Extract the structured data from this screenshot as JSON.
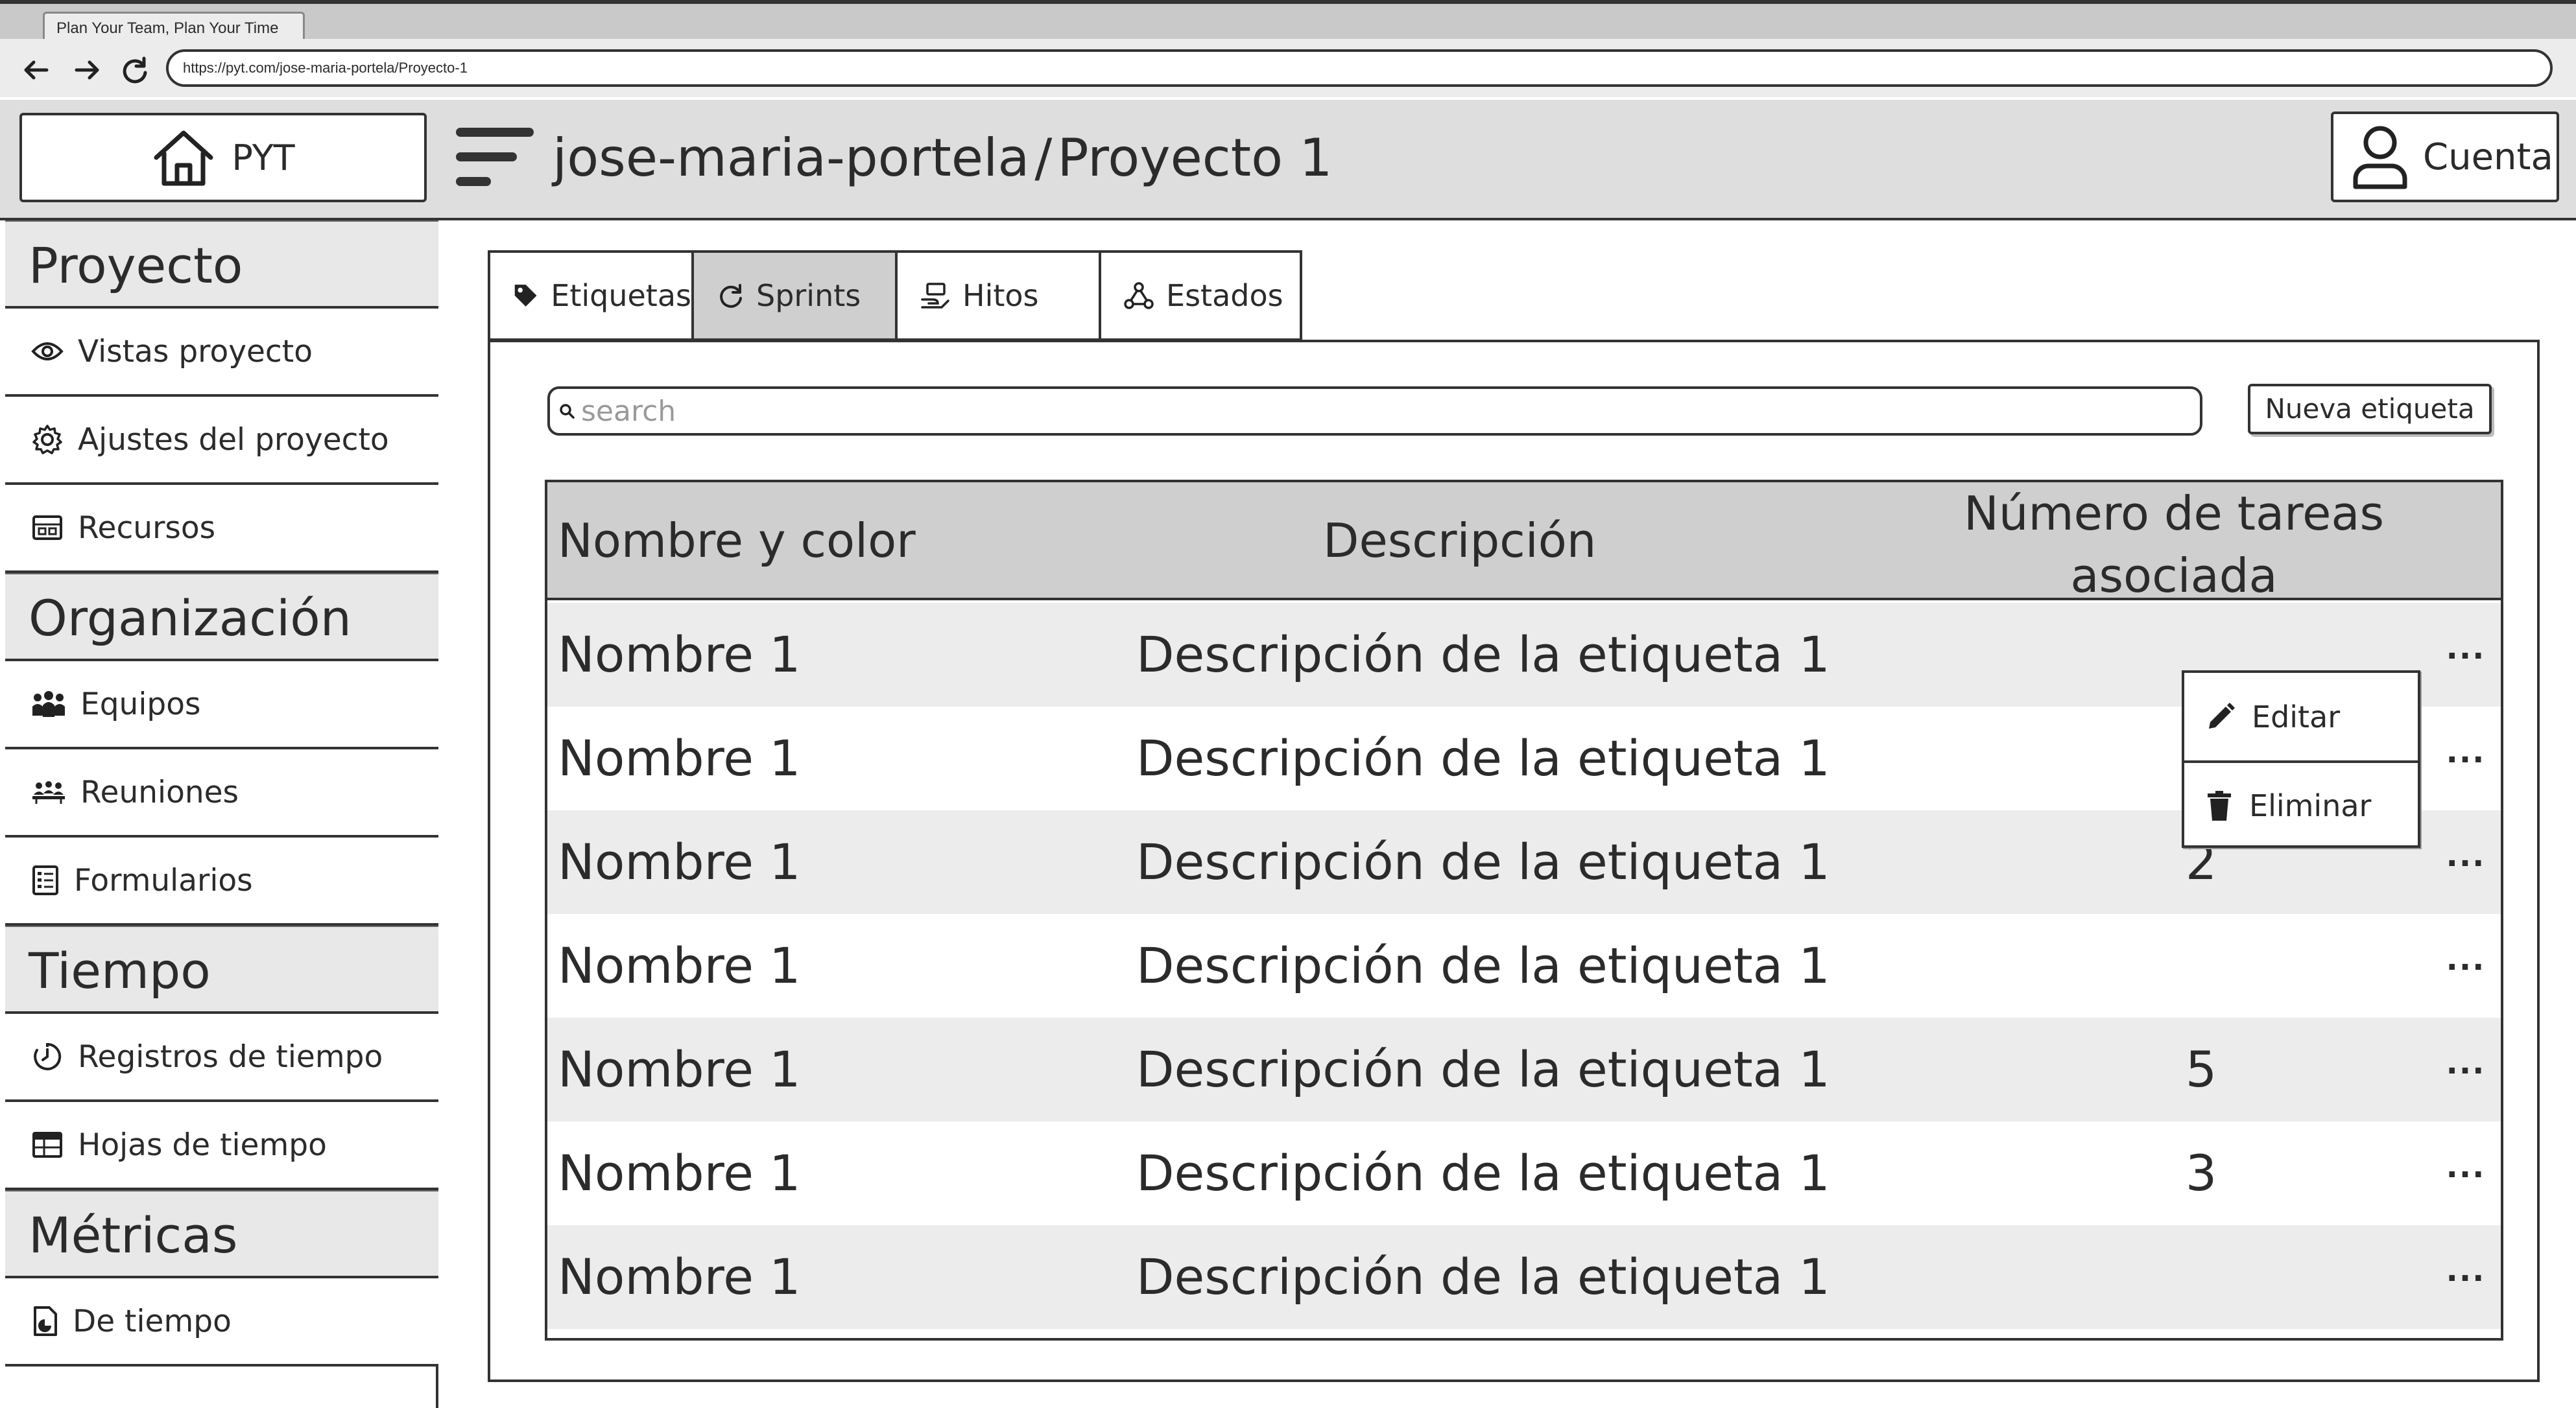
{
  "browser": {
    "tab_title": "Plan Your Team, Plan Your Time",
    "url": "https://pyt.com/jose-maria-portela/Proyecto-1"
  },
  "header": {
    "logo_text": "PYT",
    "breadcrumb_user": "jose-maria-portela",
    "breadcrumb_sep": "/",
    "breadcrumb_project": "Proyecto 1",
    "account_label": "Cuenta"
  },
  "sidebar": {
    "sections": [
      {
        "title": "Proyecto",
        "items": [
          {
            "label": "Vistas proyecto",
            "icon": "eye-icon"
          },
          {
            "label": "Ajustes del proyecto",
            "icon": "gear-icon"
          },
          {
            "label": "Recursos",
            "icon": "resources-icon"
          }
        ]
      },
      {
        "title": "Organización",
        "items": [
          {
            "label": "Equipos",
            "icon": "team-icon"
          },
          {
            "label": "Reuniones",
            "icon": "meeting-icon"
          },
          {
            "label": "Formularios",
            "icon": "form-icon"
          }
        ]
      },
      {
        "title": "Tiempo",
        "items": [
          {
            "label": "Registros de tiempo",
            "icon": "timer-icon"
          },
          {
            "label": "Hojas de tiempo",
            "icon": "table-icon"
          }
        ]
      },
      {
        "title": "Métricas",
        "items": [
          {
            "label": "De tiempo",
            "icon": "file-chart-icon"
          }
        ]
      }
    ]
  },
  "tabs": [
    {
      "label": "Etiquetas",
      "icon": "tag-icon",
      "active": false
    },
    {
      "label": "Sprints",
      "icon": "refresh-icon",
      "active": true
    },
    {
      "label": "Hitos",
      "icon": "milestone-icon",
      "active": false
    },
    {
      "label": "Estados",
      "icon": "workflow-icon",
      "active": false
    }
  ],
  "search": {
    "placeholder": "search"
  },
  "new_label_button": "Nueva etiqueta",
  "table": {
    "columns": [
      "Nombre y color",
      "Descripción",
      "Número de tareas asociada"
    ],
    "rows": [
      {
        "name": "Nombre 1",
        "description": "Descripción de la etiqueta 1",
        "count": ""
      },
      {
        "name": "Nombre 1",
        "description": "Descripción de la etiqueta 1",
        "count": ""
      },
      {
        "name": "Nombre 1",
        "description": "Descripción de la etiqueta 1",
        "count": "2"
      },
      {
        "name": "Nombre 1",
        "description": "Descripción de la etiqueta 1",
        "count": ""
      },
      {
        "name": "Nombre 1",
        "description": "Descripción de la etiqueta 1",
        "count": "5"
      },
      {
        "name": "Nombre 1",
        "description": "Descripción de la etiqueta 1",
        "count": "3"
      },
      {
        "name": "Nombre 1",
        "description": "Descripción de la etiqueta 1",
        "count": ""
      }
    ],
    "more_label": "..."
  },
  "context_menu": {
    "items": [
      {
        "label": "Editar",
        "icon": "pencil-icon"
      },
      {
        "label": "Eliminar",
        "icon": "trash-icon"
      }
    ]
  }
}
